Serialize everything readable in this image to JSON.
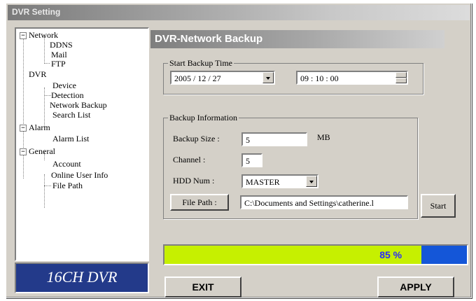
{
  "window": {
    "title": "DVR Setting"
  },
  "tree": {
    "groups": [
      {
        "label": "Network",
        "toggle": "−",
        "children": [
          "DDNS",
          "Mail",
          "FTP"
        ]
      },
      {
        "label": "DVR",
        "toggle": "−",
        "children": [
          "Device",
          "Detection",
          "Network Backup",
          "Search List"
        ]
      },
      {
        "label": "Alarm",
        "toggle": "−",
        "children": [
          "Alarm List"
        ]
      },
      {
        "label": "General",
        "toggle": "−",
        "children": [
          "Account",
          "Online User Info",
          "File Path"
        ]
      }
    ],
    "selected": "Network Backup"
  },
  "logo": {
    "text": "16CH DVR"
  },
  "panel": {
    "title": "DVR-Network Backup",
    "start_time": {
      "legend": "Start Backup Time",
      "date": "2005 / 12 / 27",
      "time": "09 : 10 : 00"
    },
    "backup_info": {
      "legend": "Backup Information",
      "size_label": "Backup Size :",
      "size_value": "5",
      "size_unit": "MB",
      "channel_label": "Channel :",
      "channel_value": "5",
      "hdd_label": "HDD Num :",
      "hdd_value": "MASTER",
      "file_path_button": "File Path :",
      "file_path_value": "C:\\Documents and Settings\\catherine.l"
    },
    "start_button": "Start"
  },
  "progress": {
    "value": 85,
    "label": "85 %"
  },
  "footer": {
    "exit_label": "EXIT",
    "apply_label": "APPLY"
  },
  "colors": {
    "progress_fill": "#c6f000",
    "progress_bg": "#1456d8",
    "logo_bg": "#233a8a"
  }
}
